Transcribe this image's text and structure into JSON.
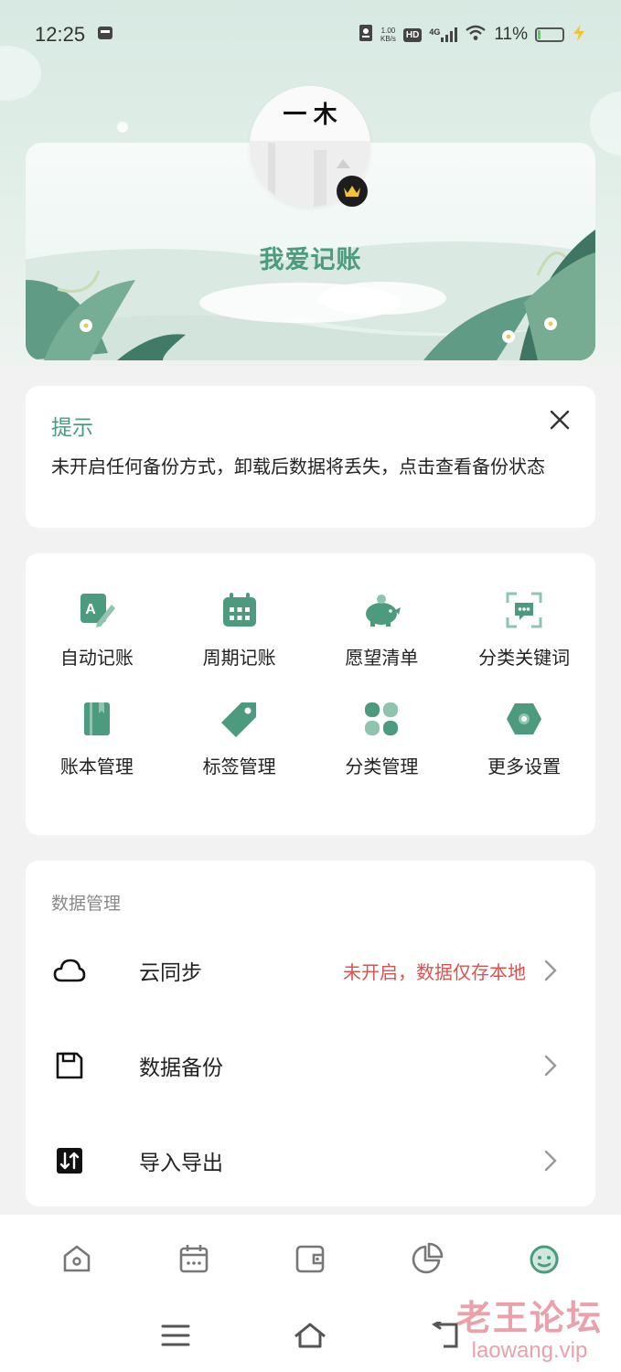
{
  "status_bar": {
    "time": "12:25",
    "speed_value": "1.00",
    "speed_unit": "KB/s",
    "hd_badge": "HD",
    "network": "4G",
    "battery": "11%",
    "battery_level": 0.11
  },
  "profile": {
    "username": "我爱记账",
    "avatar_text": "一 木"
  },
  "tip": {
    "title": "提示",
    "text": "未开启任何备份方式，卸载后数据将丢失，点击查看备份状态"
  },
  "features": [
    {
      "label": "自动记账",
      "icon": "auto-bookkeeping-icon"
    },
    {
      "label": "周期记账",
      "icon": "calendar-icon"
    },
    {
      "label": "愿望清单",
      "icon": "piggy-bank-icon"
    },
    {
      "label": "分类关键词",
      "icon": "keyword-icon"
    },
    {
      "label": "账本管理",
      "icon": "ledger-book-icon"
    },
    {
      "label": "标签管理",
      "icon": "tag-icon"
    },
    {
      "label": "分类管理",
      "icon": "category-grid-icon"
    },
    {
      "label": "更多设置",
      "icon": "settings-hexagon-icon"
    }
  ],
  "data_section": {
    "title": "数据管理",
    "rows": [
      {
        "label": "云同步",
        "status": "未开启，数据仅存本地",
        "icon": "cloud-icon"
      },
      {
        "label": "数据备份",
        "icon": "save-disk-icon"
      },
      {
        "label": "导入导出",
        "icon": "import-export-icon"
      }
    ]
  },
  "bottom_nav": [
    "home-icon",
    "calendar-icon",
    "wallet-icon",
    "pie-chart-icon",
    "profile-face-icon"
  ],
  "colors": {
    "accent": "#4c9b7f",
    "warning": "#d9534f"
  },
  "watermark": {
    "cn": "老王论坛",
    "en": "laowang.vip"
  }
}
